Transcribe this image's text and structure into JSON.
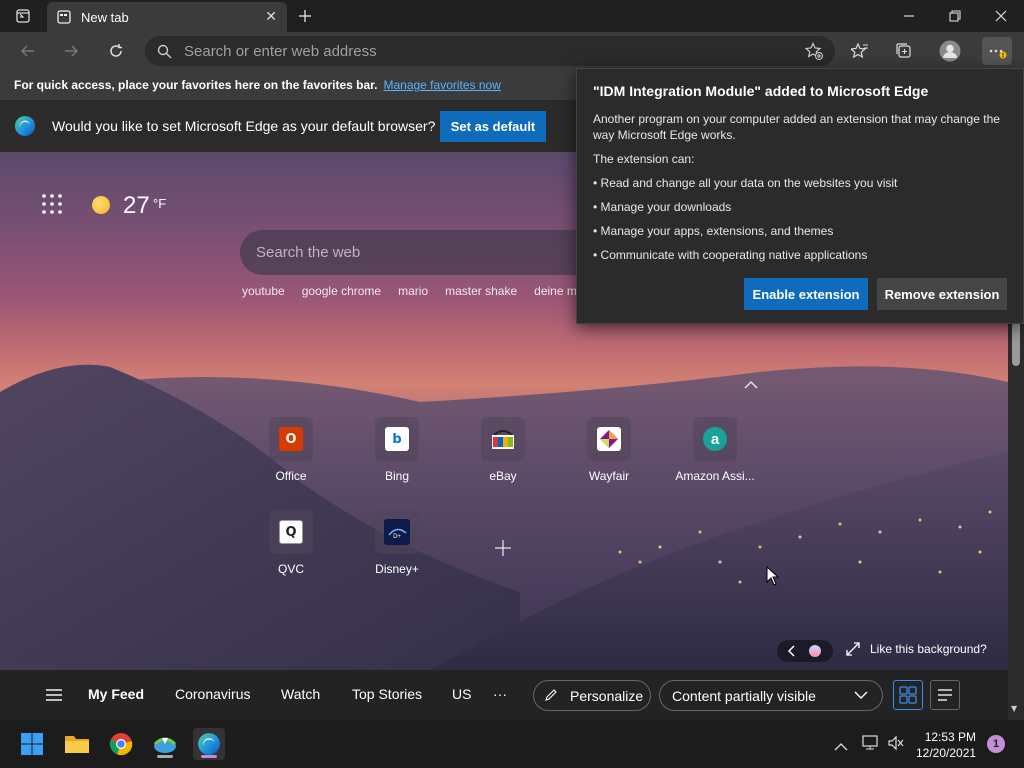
{
  "browser": {
    "tab_title": "New tab",
    "address_placeholder": "Search or enter web address"
  },
  "favorites_bar": {
    "message": "For quick access, place your favorites here on the favorites bar.",
    "link": "Manage favorites now"
  },
  "default_prompt": {
    "message": "Would you like to set Microsoft Edge as your default browser?",
    "button": "Set as default"
  },
  "weather": {
    "temp": "27",
    "unit": "°F"
  },
  "search": {
    "placeholder": "Search the web",
    "suggestions": [
      "youtube",
      "google chrome",
      "mario",
      "master shake",
      "deine mut"
    ]
  },
  "quick_links": [
    {
      "label": "Office",
      "icon": "office-icon",
      "color": "#d83b01"
    },
    {
      "label": "Bing",
      "icon": "bing-icon",
      "color": "#0078d4"
    },
    {
      "label": "eBay",
      "icon": "ebay-icon",
      "color": "#e53238"
    },
    {
      "label": "Wayfair",
      "icon": "wayfair-icon",
      "color": "#7b189f"
    },
    {
      "label": "Amazon Assi...",
      "icon": "amazon-assistant-icon",
      "color": "#1aa198"
    },
    {
      "label": "QVC",
      "icon": "qvc-icon",
      "color": "#222222"
    },
    {
      "label": "Disney+",
      "icon": "disney-plus-icon",
      "color": "#113ccf"
    }
  ],
  "background": {
    "like_text": "Like this background?"
  },
  "feed": {
    "items": [
      "My Feed",
      "Coronavirus",
      "Watch",
      "Top Stories",
      "US"
    ],
    "more": "···",
    "personalize": "Personalize",
    "content_visibility": "Content partially visible"
  },
  "extension_popup": {
    "title": "\"IDM Integration Module\" added to Microsoft Edge",
    "description": "Another program on your computer added an extension that may change the way Microsoft Edge works.",
    "can_label": "The extension can:",
    "permissions": [
      "• Read and change all your data on the websites you visit",
      "• Manage your downloads",
      "• Manage your apps, extensions, and themes",
      "• Communicate with cooperating native applications"
    ],
    "enable_button": "Enable extension",
    "remove_button": "Remove extension"
  },
  "taskbar": {
    "time": "12:53 PM",
    "date": "12/20/2021",
    "notification_count": "1"
  },
  "colors": {
    "accent": "#0f6cbd",
    "link": "#5ab4ff"
  }
}
